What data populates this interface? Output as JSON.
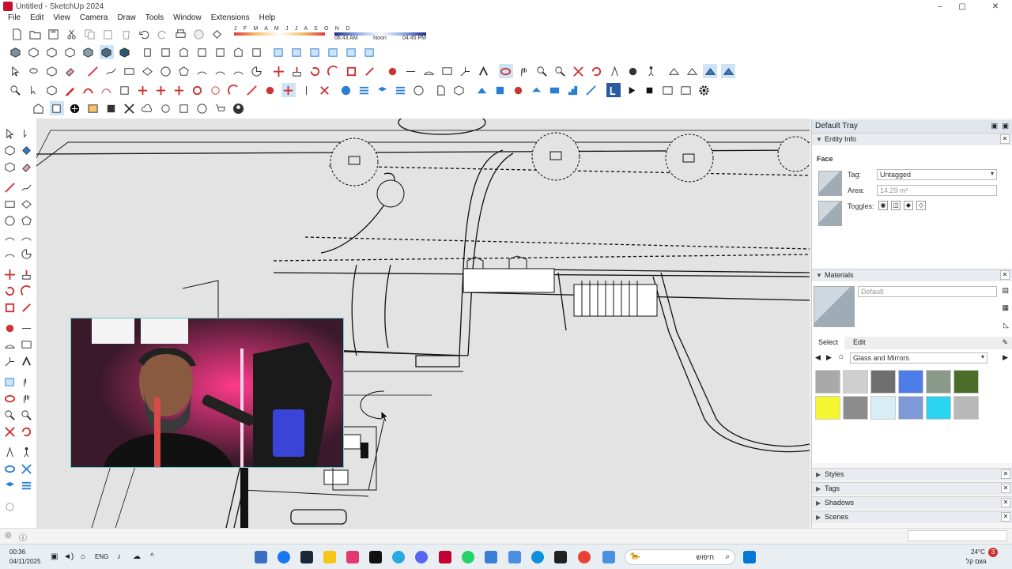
{
  "window": {
    "title": "Untitled - SketchUp 2024",
    "controls": {
      "minimize": "–",
      "maximize": "▢",
      "close": "✕"
    }
  },
  "menu": [
    "File",
    "Edit",
    "View",
    "Camera",
    "Draw",
    "Tools",
    "Window",
    "Extensions",
    "Help"
  ],
  "shadows": {
    "months": "J F M A M J J A S O N D",
    "time_start": "06:43 AM",
    "time_noon": "Noon",
    "time_end": "04:45 PM"
  },
  "tray": {
    "title": "Default Tray",
    "entity_info": {
      "header": "Entity Info",
      "type": "Face",
      "tag_label": "Tag:",
      "tag_value": "Untagged",
      "area_label": "Area:",
      "area_value": "14.29 m²",
      "toggles_label": "Toggles:"
    },
    "materials": {
      "header": "Materials",
      "name_value": "Default",
      "tab_select": "Select",
      "tab_edit": "Edit",
      "collection": "Glass and Mirrors",
      "swatch_colors": [
        "#a9a9a9",
        "#cfcfcf",
        "#6f6f6f",
        "#4c7de8",
        "#8a9a8a",
        "#4a6e2a",
        "#f5f530",
        "#8c8c8c",
        "#d8eef5",
        "#7f98d8",
        "#2ad4f0",
        "#b8b8b8"
      ]
    },
    "collapsed_panels": [
      "Styles",
      "Tags",
      "Shadows",
      "Scenes"
    ]
  },
  "taskbar": {
    "time": "00:36",
    "date": "04/11/2025",
    "language": "ENG",
    "search_text": "חיפוש",
    "weather_temp": "24°C",
    "weather_desc": "גשם קל",
    "notification_count": "3"
  },
  "colors": {
    "accent": "#2a7fd4",
    "viewport_bg": "#e3e3e3",
    "tray_header": "#dfe6ee"
  }
}
